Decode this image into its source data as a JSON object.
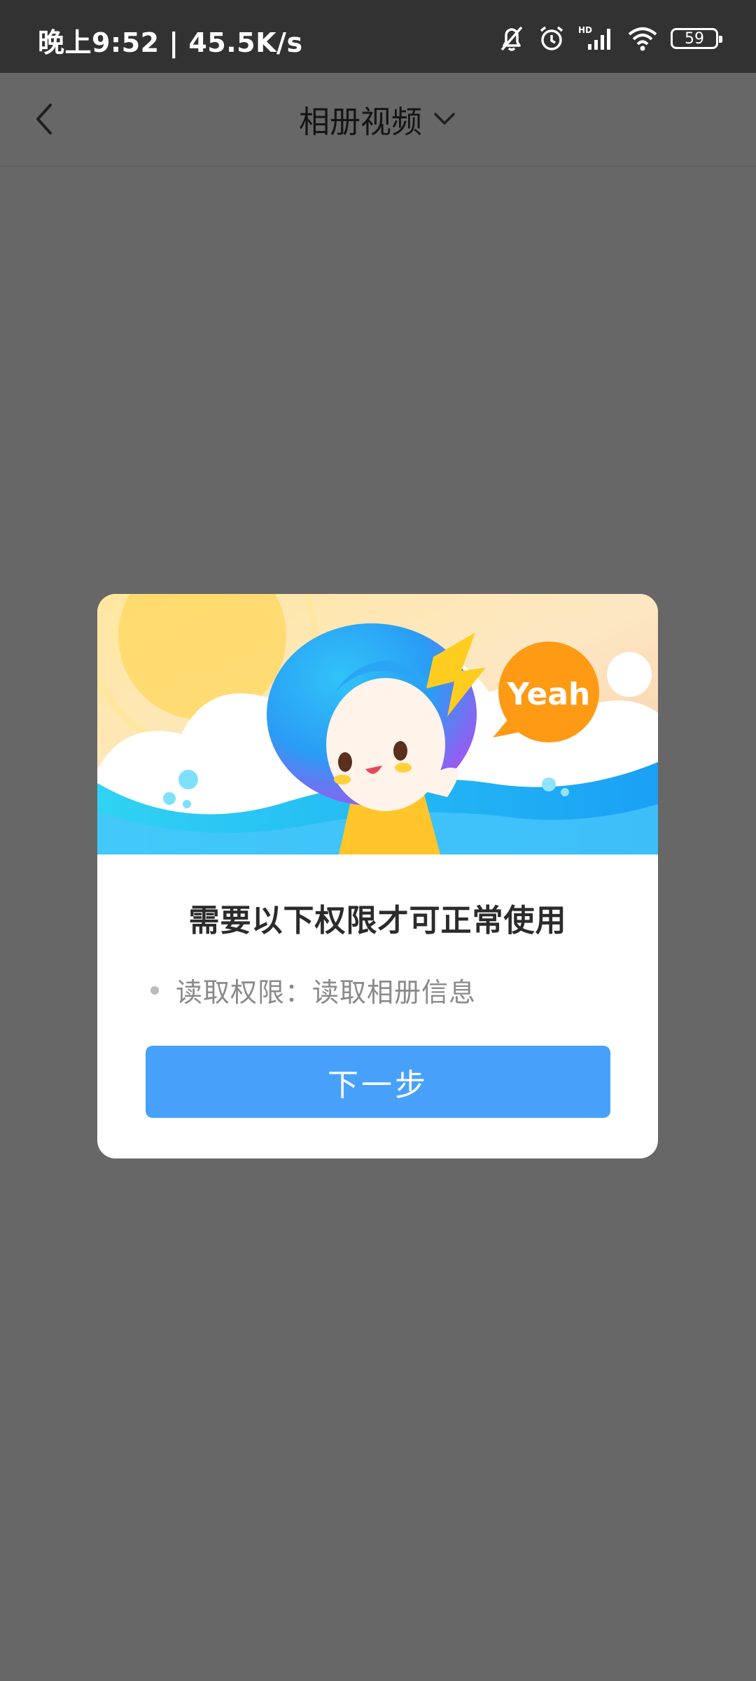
{
  "status_bar": {
    "time_speed": "晚上9:52 | 45.5K/s",
    "battery_level": "59",
    "icons": [
      "mute-icon",
      "alarm-icon",
      "signal-hd-icon",
      "wifi-icon",
      "battery-icon"
    ]
  },
  "header": {
    "title": "相册视频",
    "back_icon": "chevron-left-icon",
    "dropdown_icon": "chevron-down-icon"
  },
  "dialog": {
    "banner_bubble": "Yeah",
    "title": "需要以下权限才可正常使用",
    "permissions": [
      {
        "text": "读取权限：读取相册信息"
      }
    ],
    "next_button": "下一步"
  },
  "colors": {
    "overlay": "#676767",
    "status_bar": "#323232",
    "primary_button": "#47a1fb",
    "dialog_bg": "#ffffff"
  }
}
